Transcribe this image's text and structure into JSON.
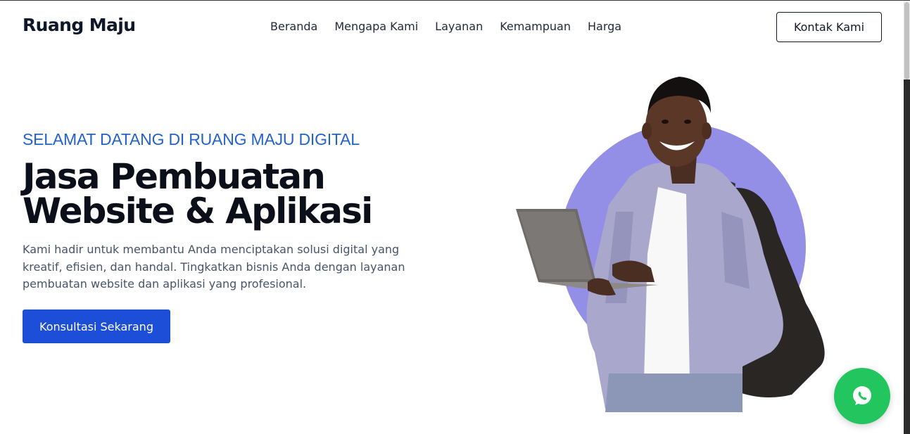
{
  "header": {
    "brand": "Ruang Maju",
    "nav": [
      "Beranda",
      "Mengapa Kami",
      "Layanan",
      "Kemampuan",
      "Harga"
    ],
    "contact_label": "Kontak Kami"
  },
  "hero": {
    "eyebrow": "SELAMAT DATANG DI RUANG MAJU DIGITAL",
    "headline_line1": "Jasa Pembuatan",
    "headline_line2": "Website & Aplikasi",
    "description": "Kami hadir untuk membantu Anda menciptakan solusi digital yang kreatif, efisien, dan handal. Tingkatkan bisnis Anda dengan layanan pembuatan website dan aplikasi yang profesional.",
    "cta_label": "Konsultasi Sekarang",
    "image": "smiling student holding laptop with backpack in front of purple circle"
  },
  "chat_fab": {
    "icon": "whatsapp-icon"
  },
  "colors": {
    "accent_blue": "#1d4ed8",
    "eyebrow_blue": "#2563c9",
    "circle_purple": "#948fe6",
    "chat_green": "#22c55e",
    "text_dark": "#0b0f1a",
    "text_muted": "#475569"
  }
}
